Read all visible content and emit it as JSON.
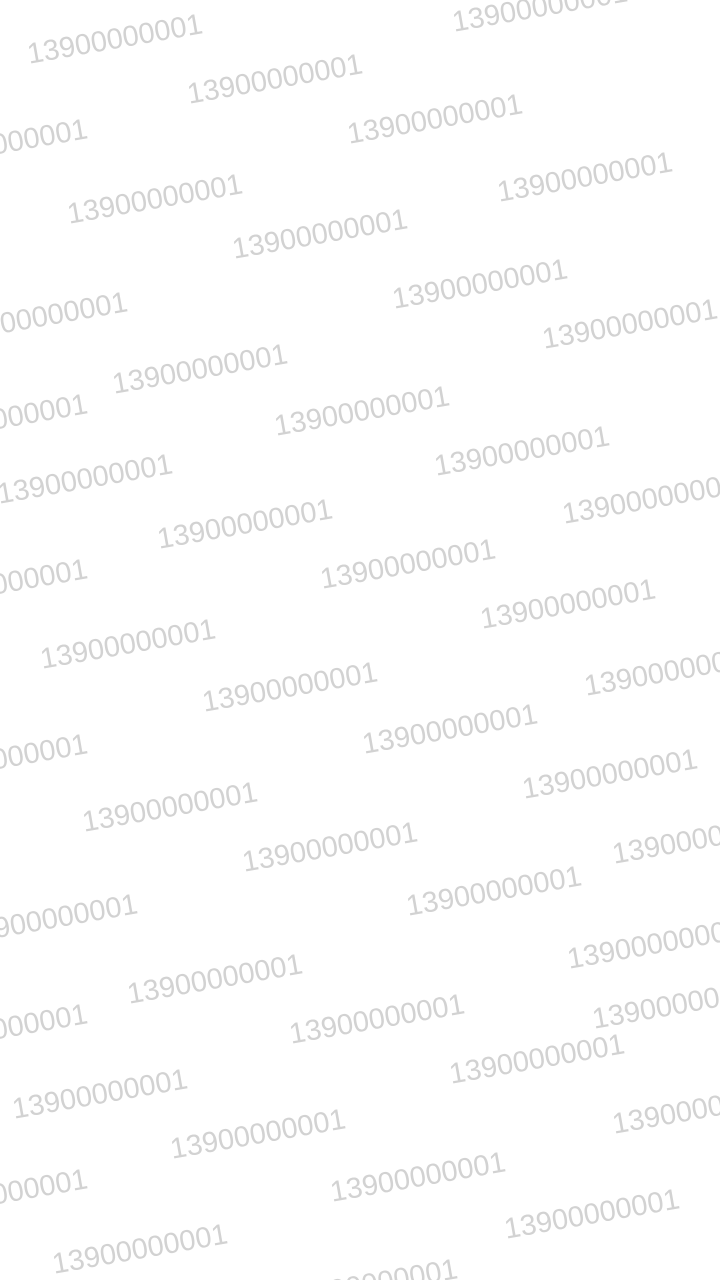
{
  "watermark": {
    "text": "13900000001",
    "color": "#d2d2d2"
  }
}
